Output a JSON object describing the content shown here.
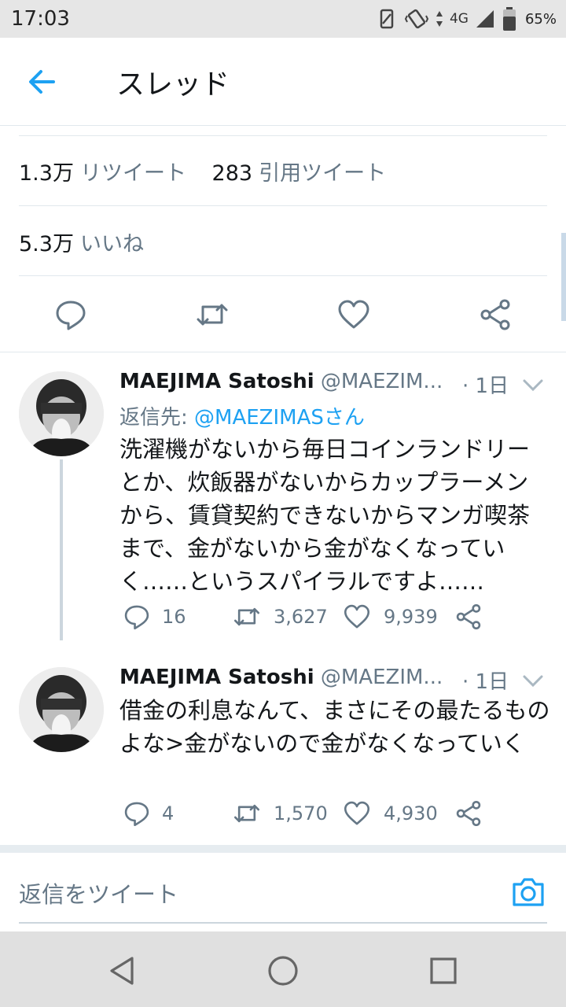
{
  "status_bar": {
    "time": "17:03",
    "network": "4G",
    "battery": "65%"
  },
  "header": {
    "title": "スレッド",
    "back_icon": "arrow-left-icon",
    "accent": "#1da1f2"
  },
  "stats": {
    "retweets_count": "1.3万",
    "retweets_label": "リツイート",
    "quotes_count": "283",
    "quotes_label": "引用ツイート",
    "likes_count": "5.3万",
    "likes_label": "いいね"
  },
  "action_bar": {
    "icons": [
      "reply-icon",
      "retweet-icon",
      "like-icon",
      "share-icon"
    ]
  },
  "tweets": [
    {
      "name": "MAEJIMA Satoshi",
      "handle": "@MAEZIM...",
      "time": "· 1日",
      "reply_prefix": "返信先:",
      "reply_to": "@MAEZIMASさん",
      "text": "洗濯機がないから毎日コインランドリーとか、炊飯器がないからカップラーメンから、賃貸契約できないからマンガ喫茶まで、金がないから金がなくなっていく……というスパイラルですよ……",
      "replies": "16",
      "retweets": "3,627",
      "likes": "9,939"
    },
    {
      "name": "MAEJIMA Satoshi",
      "handle": "@MAEZIM...",
      "time": "· 1日",
      "text": "借金の利息なんて、まさにその最たるものよな>金がないので金がなくなっていく",
      "replies": "4",
      "retweets": "1,570",
      "likes": "4,930"
    }
  ],
  "composer": {
    "placeholder": "返信をツイート",
    "camera_icon": "camera-icon"
  },
  "nav_bar": {
    "icons": [
      "back-triangle-icon",
      "home-circle-icon",
      "recents-square-icon"
    ]
  }
}
